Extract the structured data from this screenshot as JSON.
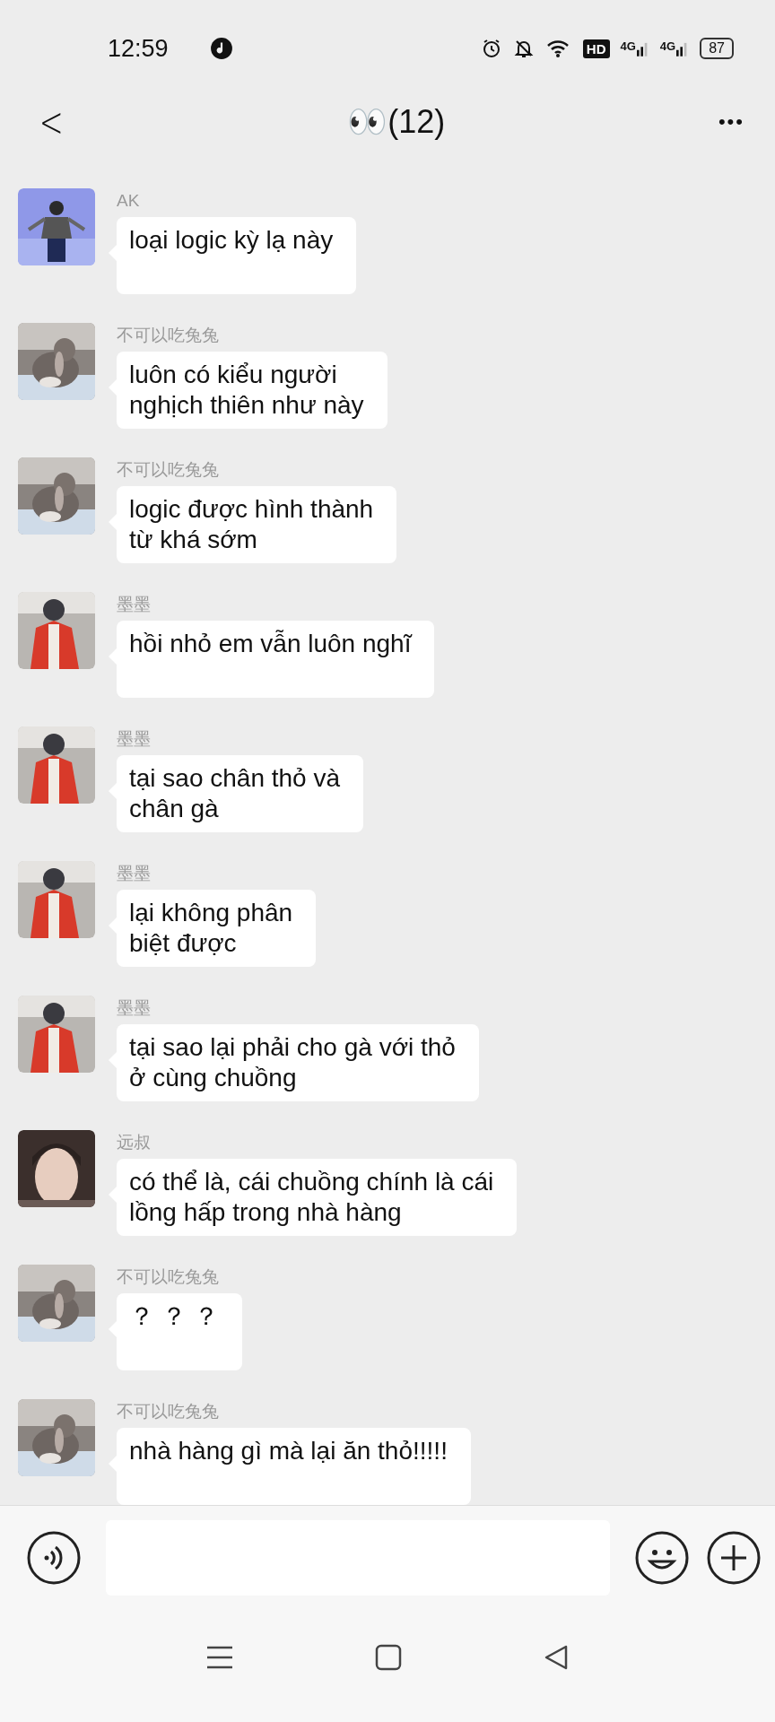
{
  "status_bar": {
    "time": "12:59",
    "network_badge": "HD",
    "signal_labels": [
      "4G",
      "4G"
    ],
    "battery": "87"
  },
  "header": {
    "back": "<",
    "title": "👀(12)",
    "more": "•••"
  },
  "messages": [
    {
      "sender": "AK",
      "lines": [
        "loại logic kỳ lạ này"
      ]
    },
    {
      "sender": "不可以吃兔兔",
      "lines": [
        "luôn có kiểu người",
        "nghịch thiên như này"
      ]
    },
    {
      "sender": "不可以吃兔兔",
      "lines": [
        "logic được hình thành",
        "từ khá sớm"
      ]
    },
    {
      "sender": "墨墨",
      "lines": [
        "hồi nhỏ em vẫn luôn nghĩ"
      ]
    },
    {
      "sender": "墨墨",
      "lines": [
        "tại sao chân thỏ và",
        "chân gà"
      ]
    },
    {
      "sender": "墨墨",
      "lines": [
        "lại không phân",
        "biệt được"
      ]
    },
    {
      "sender": "墨墨",
      "lines": [
        "tại sao lại phải cho gà với thỏ",
        "ở cùng chuồng"
      ]
    },
    {
      "sender": "远叔",
      "lines": [
        "có thể là, cái chuồng chính là cái",
        "lồng hấp trong nhà hàng"
      ]
    },
    {
      "sender": "不可以吃兔兔",
      "lines": [
        "？ ？ ？"
      ]
    },
    {
      "sender": "不可以吃兔兔",
      "lines": [
        "nhà hàng gì mà lại ăn thỏ!!!!!"
      ]
    }
  ]
}
